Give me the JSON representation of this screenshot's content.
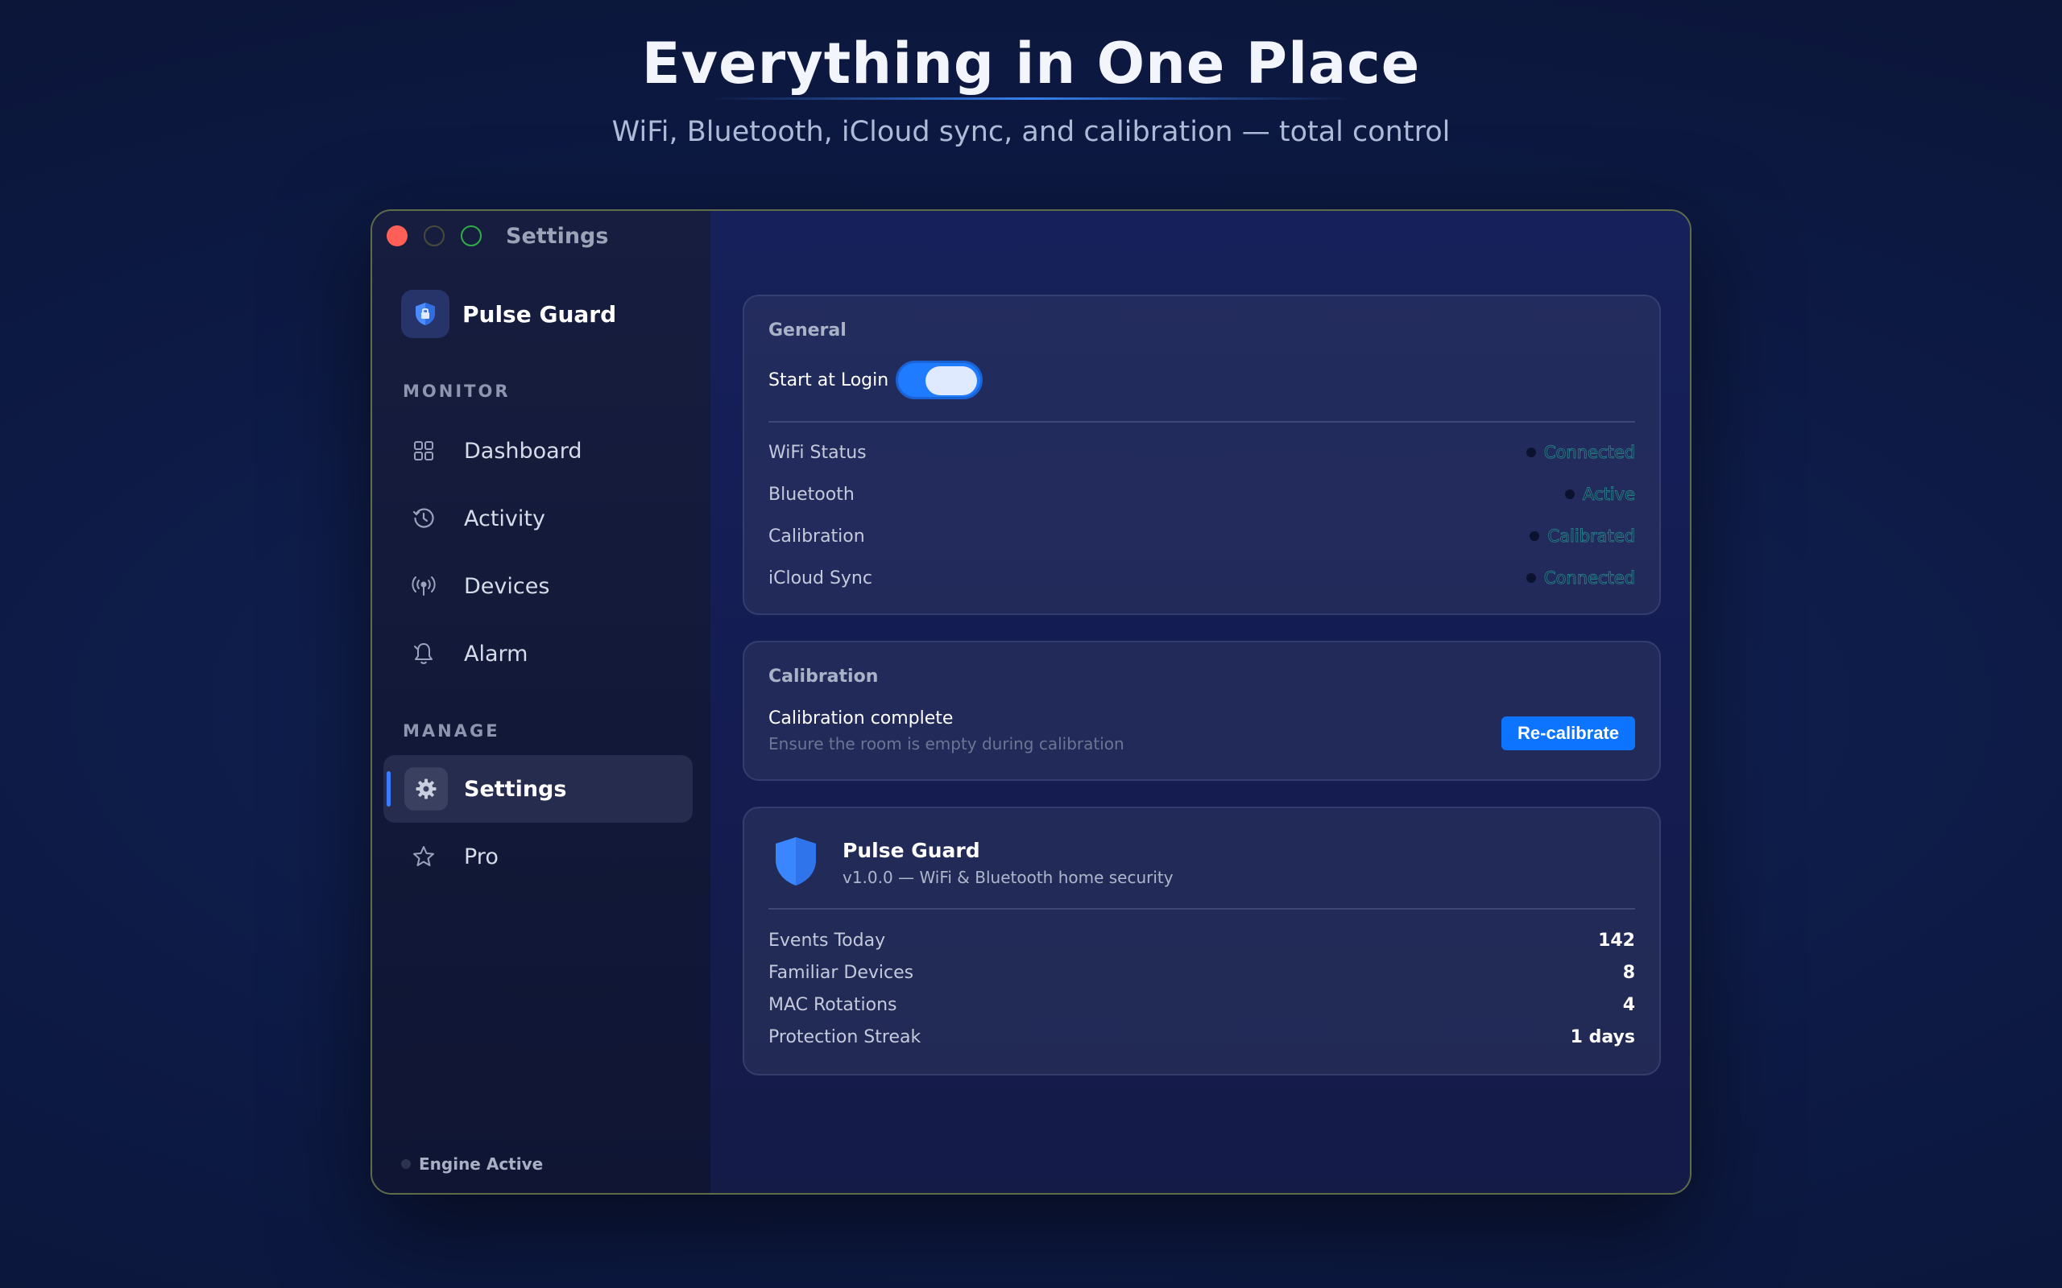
{
  "hero": {
    "title": "Everything in One Place",
    "subtitle": "WiFi, Bluetooth, iCloud sync, and calibration — total control"
  },
  "window": {
    "title": "Settings"
  },
  "sidebar": {
    "brand": "Pulse Guard",
    "sections": {
      "monitor": "MONITOR",
      "manage": "MANAGE"
    },
    "monitor_items": [
      {
        "label": "Dashboard",
        "icon": "grid-icon"
      },
      {
        "label": "Activity",
        "icon": "history-icon"
      },
      {
        "label": "Devices",
        "icon": "antenna-icon"
      },
      {
        "label": "Alarm",
        "icon": "bell-icon"
      }
    ],
    "manage_items": [
      {
        "label": "Settings",
        "icon": "gear-icon",
        "active": true
      },
      {
        "label": "Pro",
        "icon": "star-icon"
      }
    ],
    "footer": "Engine Active"
  },
  "general": {
    "title": "General",
    "start_at_login": {
      "label": "Start at Login",
      "enabled": true
    },
    "rows": [
      {
        "label": "WiFi Status",
        "status": "Connected"
      },
      {
        "label": "Bluetooth",
        "status": "Active"
      },
      {
        "label": "Calibration",
        "status": "Calibrated"
      },
      {
        "label": "iCloud Sync",
        "status": "Connected"
      }
    ]
  },
  "calibration": {
    "title": "Calibration",
    "status": "Calibration complete",
    "hint": "Ensure the room is empty during calibration",
    "button": "Re-calibrate"
  },
  "about": {
    "name": "Pulse Guard",
    "version": "v1.0.0 — WiFi & Bluetooth home security",
    "stats": [
      {
        "label": "Events Today",
        "value": "142"
      },
      {
        "label": "Familiar Devices",
        "value": "8"
      },
      {
        "label": "MAC Rotations",
        "value": "4"
      },
      {
        "label": "Protection Streak",
        "value": "1 days"
      }
    ]
  },
  "colors": {
    "accent": "#0d74ff",
    "close": "#ff5f57",
    "maximize": "#2fae45"
  }
}
